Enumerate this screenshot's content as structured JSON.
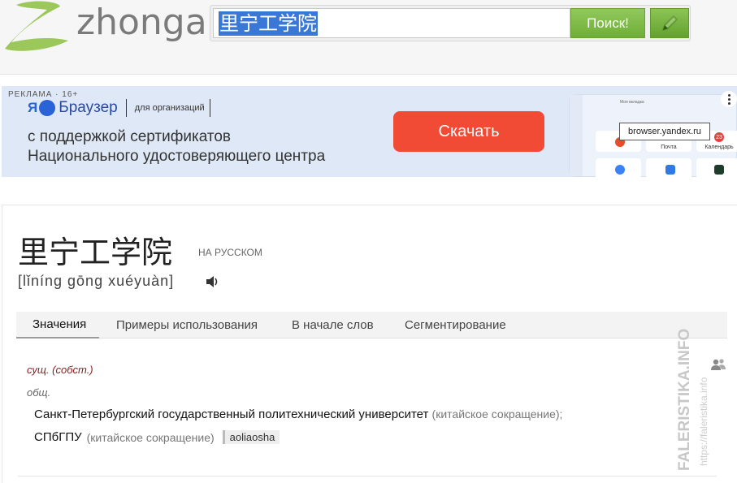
{
  "header": {
    "logo_text": "zhonga",
    "search_value": "里宁工学院",
    "search_button": "Поиск!",
    "edit_icon": "pencil-icon"
  },
  "ad": {
    "label": "РЕКЛАМА · 16+",
    "brand_mark": "Я",
    "brand_name": "Браузер",
    "brand_suffix": "для организаций",
    "text_line1": "с поддержкой сертификатов",
    "text_line2": "Национального удостоверяющего центра",
    "button": "Скачать",
    "tooltip": "browser.yandex.ru",
    "panel_tile_mail": "Почта",
    "panel_tile_calendar": "Календарь",
    "panel_badge": "23",
    "panel_tab": "Моя вкладка"
  },
  "entry": {
    "word": "里宁工学院",
    "lang_label": "НА РУССКОМ",
    "pinyin": "[lǐníng gōng xuéyuàn]",
    "speaker_icon": "speaker-icon"
  },
  "tabs": [
    {
      "label": "Значения",
      "active": true
    },
    {
      "label": "Примеры использования",
      "active": false
    },
    {
      "label": "В начале слов",
      "active": false
    },
    {
      "label": "Сегментирование",
      "active": false
    }
  ],
  "meaning": {
    "part_of_speech": "сущ. (собст.)",
    "domain": "общ.",
    "translation1": "Санкт-Петербургский государственный политехнический университет",
    "note1": "(китайское сокращение);",
    "translation2": "СПбГПУ",
    "note2": "(китайское сокращение)",
    "author_tag": "aoliaosha"
  },
  "watermark": {
    "line1": "FALERISTIKA.INFO",
    "line2": "https://faleristika.info"
  },
  "colors": {
    "search_button": "#7bb843",
    "ad_button": "#f24b35",
    "pos_text": "#8b1d1d"
  }
}
